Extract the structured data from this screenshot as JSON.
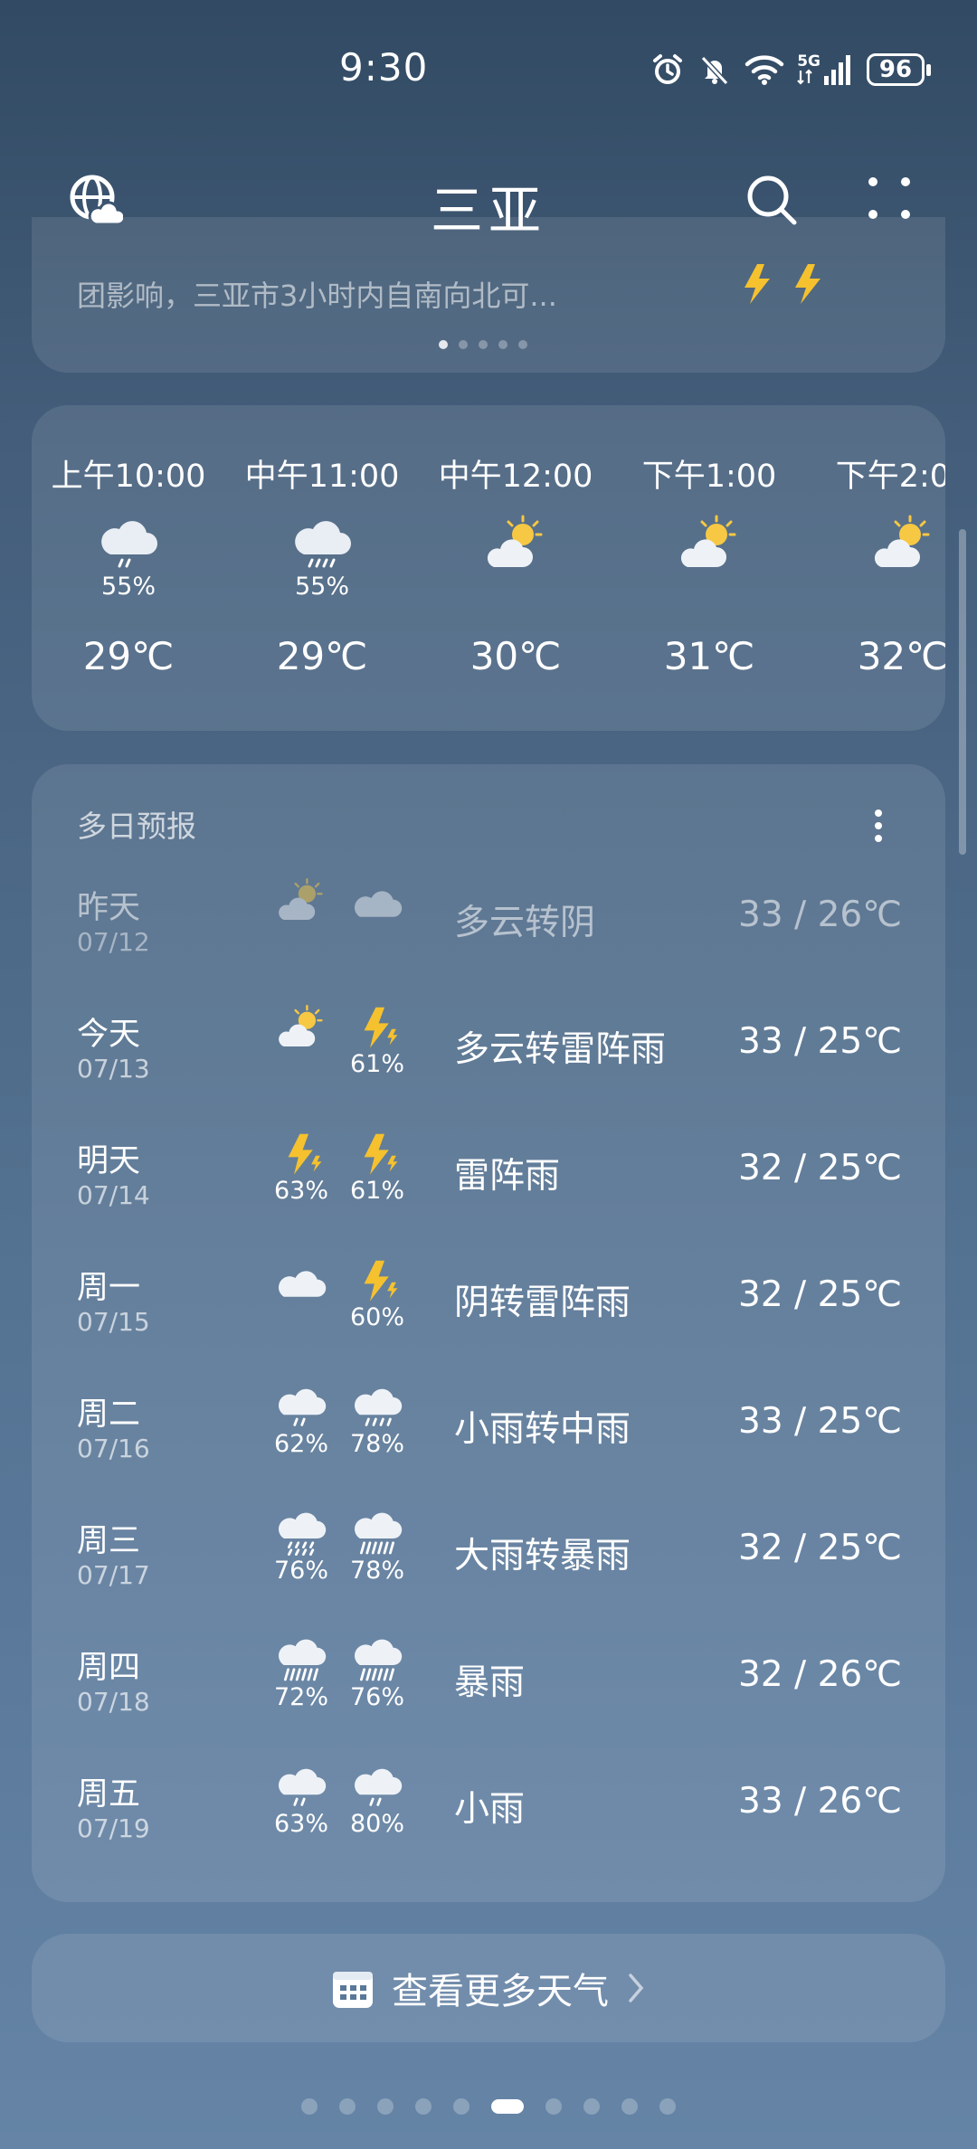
{
  "status": {
    "time": "9:30",
    "network": "5G",
    "battery": "96",
    "icons": [
      "alarm-icon",
      "mute-icon",
      "wifi-icon",
      "signal-icon",
      "battery-icon"
    ]
  },
  "header": {
    "city": "三亚",
    "left_icon": "globe-weather-icon",
    "search_icon": "search-icon",
    "more_icon": "grid-dots-icon"
  },
  "alert": {
    "text": "团影响，三亚市3小时内自南向北可..."
  },
  "hourly": [
    {
      "time": "上午10:00",
      "icon": "rain-cloud-icon",
      "pct": "55%",
      "temp": "29℃"
    },
    {
      "time": "中午11:00",
      "icon": "rain-cloud-icon",
      "pct": "55%",
      "temp": "29℃"
    },
    {
      "time": "中午12:00",
      "icon": "partly-cloudy-icon",
      "pct": "",
      "temp": "30℃"
    },
    {
      "time": "下午1:00",
      "icon": "partly-cloudy-icon",
      "pct": "",
      "temp": "31℃"
    },
    {
      "time": "下午2:00",
      "icon": "partly-cloudy-icon",
      "pct": "",
      "temp": "32℃"
    }
  ],
  "daily": {
    "title": "多日预报",
    "days": [
      {
        "name": "昨天",
        "date": "07/12",
        "icon1": "partly-cloudy-icon",
        "pct1": "",
        "icon2": "cloud-icon",
        "pct2": "",
        "desc": "多云转阴",
        "temp": "33 / 26℃"
      },
      {
        "name": "今天",
        "date": "07/13",
        "icon1": "partly-cloudy-icon",
        "pct1": "",
        "icon2": "thunder-icon",
        "pct2": "61%",
        "desc": "多云转雷阵雨",
        "temp": "33 / 25℃"
      },
      {
        "name": "明天",
        "date": "07/14",
        "icon1": "thunder-icon",
        "pct1": "63%",
        "icon2": "thunder-icon",
        "pct2": "61%",
        "desc": "雷阵雨",
        "temp": "32 / 25℃"
      },
      {
        "name": "周一",
        "date": "07/15",
        "icon1": "cloud-icon",
        "pct1": "",
        "icon2": "thunder-icon",
        "pct2": "60%",
        "desc": "阴转雷阵雨",
        "temp": "32 / 25℃"
      },
      {
        "name": "周二",
        "date": "07/16",
        "icon1": "light-rain-icon",
        "pct1": "62%",
        "icon2": "moderate-rain-icon",
        "pct2": "78%",
        "desc": "小雨转中雨",
        "temp": "33 / 25℃"
      },
      {
        "name": "周三",
        "date": "07/17",
        "icon1": "heavy-rain-icon",
        "pct1": "76%",
        "icon2": "storm-rain-icon",
        "pct2": "78%",
        "desc": "大雨转暴雨",
        "temp": "32 / 25℃"
      },
      {
        "name": "周四",
        "date": "07/18",
        "icon1": "storm-rain-icon",
        "pct1": "72%",
        "icon2": "storm-rain-icon",
        "pct2": "76%",
        "desc": "暴雨",
        "temp": "32 / 26℃"
      },
      {
        "name": "周五",
        "date": "07/19",
        "icon1": "light-rain-icon",
        "pct1": "63%",
        "icon2": "light-rain-icon",
        "pct2": "80%",
        "desc": "小雨",
        "temp": "33 / 26℃"
      }
    ]
  },
  "more_weather": {
    "label": "查看更多天气",
    "icon": "calendar-icon"
  },
  "page_dots": {
    "active_index": 5
  },
  "colors": {
    "sun": "#f7c843",
    "bolt": "#f5c12e",
    "cloud": "#e9eef4"
  }
}
